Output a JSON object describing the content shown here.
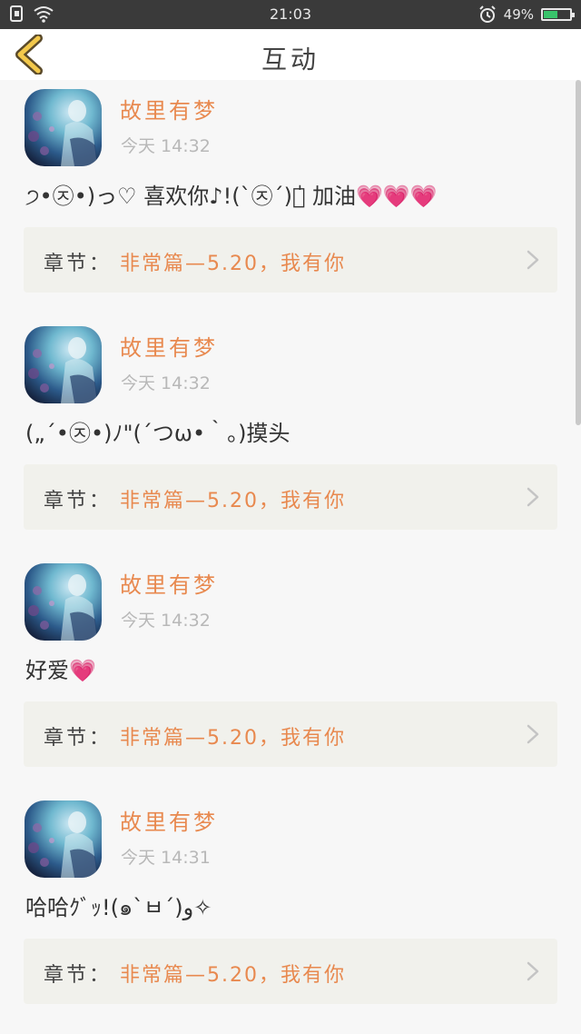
{
  "status_bar": {
    "time": "21:03",
    "battery": "49%",
    "battery_level": 0.49
  },
  "header": {
    "title": "互动"
  },
  "colors": {
    "accent": "#e8894f",
    "card_bg": "#f1f1ec"
  },
  "comments": [
    {
      "username": "故里有梦",
      "timestamp": "今天 14:32",
      "text": "੭•㉨•)っ♡ 喜欢你♪!(ˋ㉨ˊ)ง̍ 加油💗💗💗",
      "chapter_label": "章节：",
      "chapter_name": "非常篇—5.20，我有你"
    },
    {
      "username": "故里有梦",
      "timestamp": "今天 14:32",
      "text": "(„ˊ•㉨•)ﾉ\"(ˊつω•｀。)摸头",
      "chapter_label": "章节：",
      "chapter_name": "非常篇—5.20，我有你"
    },
    {
      "username": "故里有梦",
      "timestamp": "今天 14:32",
      "text": "好爱💗",
      "chapter_label": "章节：",
      "chapter_name": "非常篇—5.20，我有你"
    },
    {
      "username": "故里有梦",
      "timestamp": "今天 14:31",
      "text": "哈哈ｸﾞｯ!(๑ˋㅂˊ)و✧",
      "chapter_label": "章节：",
      "chapter_name": "非常篇—5.20，我有你"
    }
  ]
}
